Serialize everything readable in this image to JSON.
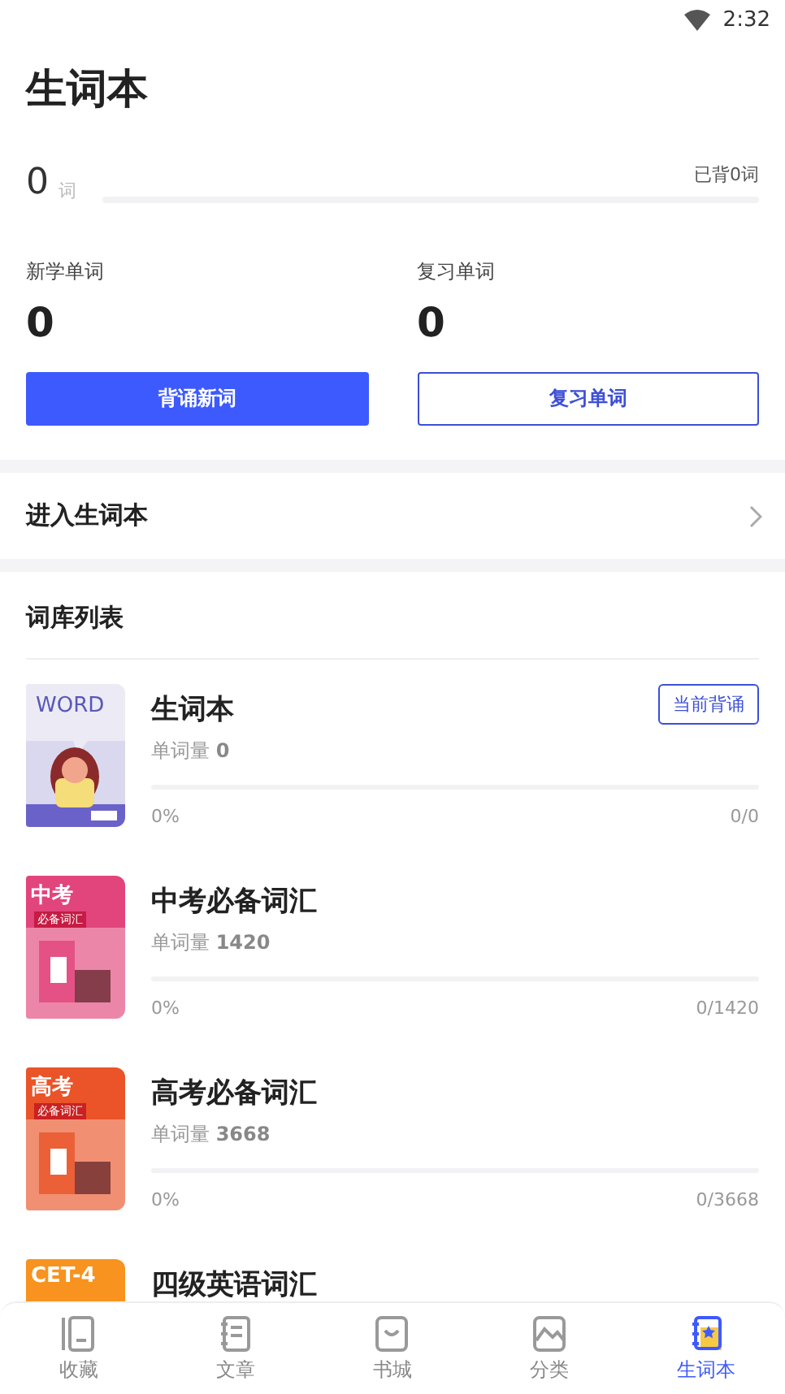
{
  "status_bar": {
    "time": "2:32"
  },
  "title": "生词本",
  "summary": {
    "count": "0",
    "unit": "词",
    "learned": "已背0词"
  },
  "stats": [
    {
      "label": "新学单词",
      "value": "0"
    },
    {
      "label": "复习单词",
      "value": "0"
    }
  ],
  "buttons": [
    {
      "label": "背诵新词",
      "kind": "primary"
    },
    {
      "label": "复习单词",
      "kind": "outline"
    }
  ],
  "enter_link": {
    "label": "进入生词本"
  },
  "library": {
    "heading": "词库列表",
    "items": [
      {
        "name": "生词本",
        "count_label": "单词量",
        "count": "0",
        "percent": "0%",
        "progress": "0/0",
        "badge": "当前背诵",
        "cover": {
          "kind": "illustration",
          "title": "WORD",
          "color": "#d9d8ee"
        }
      },
      {
        "name": "中考必备词汇",
        "count_label": "单词量",
        "count": "1420",
        "percent": "0%",
        "progress": "0/1420",
        "cover": {
          "kind": "pattern",
          "title": "中考",
          "subtitle": "必备词汇",
          "color": "#e2457c"
        }
      },
      {
        "name": "高考必备词汇",
        "count_label": "单词量",
        "count": "3668",
        "percent": "0%",
        "progress": "0/3668",
        "cover": {
          "kind": "pattern",
          "title": "高考",
          "subtitle": "必备词汇",
          "color": "#ea5428"
        }
      },
      {
        "name": "四级英语词汇",
        "cover": {
          "kind": "pattern",
          "title": "CET-4",
          "color": "#f7931e"
        }
      }
    ]
  },
  "nav": [
    {
      "label": "收藏",
      "selected": false
    },
    {
      "label": "文章",
      "selected": false
    },
    {
      "label": "书城",
      "selected": false
    },
    {
      "label": "分类",
      "selected": false
    },
    {
      "label": "生词本",
      "selected": true
    }
  ]
}
